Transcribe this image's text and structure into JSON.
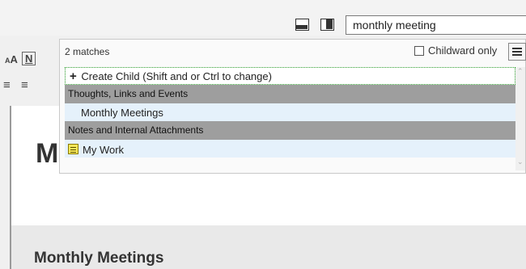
{
  "toolbar": {
    "search_value": "monthly meeting",
    "layout_buttons": [
      "bottom-panel-layout-icon",
      "side-panel-layout-icon"
    ]
  },
  "left_tools": {
    "font_size_label": "AA",
    "normal_text_label": "N",
    "align_center_icon": "align-center-icon",
    "align_right_icon": "align-right-icon"
  },
  "popup": {
    "match_count": "2 matches",
    "childward_label": "Childward only",
    "childward_checked": false,
    "create_child_label": "Create Child (Shift and or Ctrl to change)",
    "groups": [
      {
        "label": "Thoughts, Links and Events",
        "items": [
          {
            "label": "Monthly Meetings"
          }
        ]
      },
      {
        "label": "Notes and Internal Attachments",
        "items": [
          {
            "label": "My Work",
            "icon": "note-icon"
          }
        ]
      }
    ]
  },
  "document": {
    "title_partial": "M",
    "heading": "Monthly Meetings"
  },
  "colors": {
    "group_header_bg": "#9e9e9e",
    "item_bg": "#e5f1fb",
    "create_border": "#2a9a2a"
  }
}
